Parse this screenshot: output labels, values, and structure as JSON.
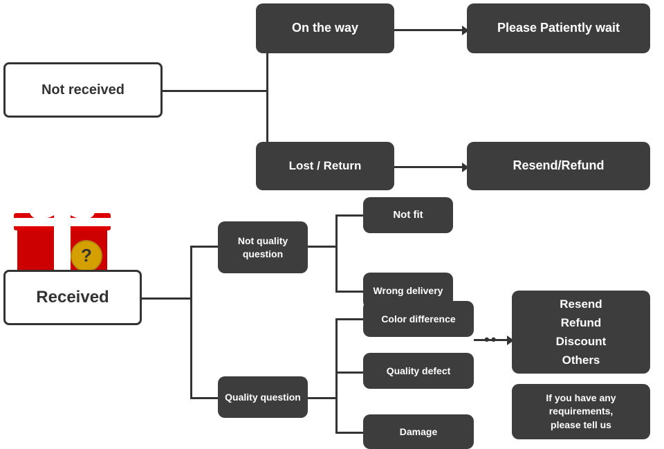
{
  "boxes": {
    "not_received": {
      "label": "Not received"
    },
    "on_the_way": {
      "label": "On the way"
    },
    "please_wait": {
      "label": "Please Patiently wait"
    },
    "lost_return": {
      "label": "Lost / Return"
    },
    "resend_refund_top": {
      "label": "Resend/Refund"
    },
    "received": {
      "label": "Received"
    },
    "not_quality_q": {
      "label": "Not quality\nquestion"
    },
    "quality_q": {
      "label": "Quality question"
    },
    "not_fit": {
      "label": "Not fit"
    },
    "wrong_delivery": {
      "label": "Wrong delivery"
    },
    "color_diff": {
      "label": "Color difference"
    },
    "quality_defect": {
      "label": "Quality defect"
    },
    "damage": {
      "label": "Damage"
    },
    "resend_refund_options": {
      "label": "Resend\nRefund\nDiscount\nOthers"
    },
    "requirements": {
      "label": "If you have any\nrequirements,\nplease tell us"
    }
  }
}
